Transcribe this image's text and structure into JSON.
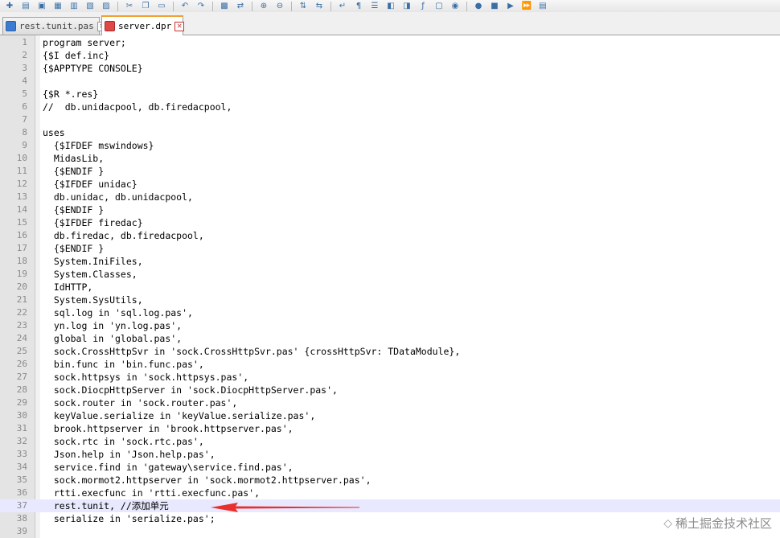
{
  "toolbar": {
    "buttons": [
      {
        "name": "new-file-icon",
        "glyph": "✚"
      },
      {
        "name": "open-file-icon",
        "glyph": "▤"
      },
      {
        "name": "save-icon",
        "glyph": "▣"
      },
      {
        "name": "save-all-icon",
        "glyph": "▦"
      },
      {
        "name": "close-file-icon",
        "glyph": "▥"
      },
      {
        "name": "close-all-icon",
        "glyph": "▧"
      },
      {
        "name": "print-icon",
        "glyph": "▨"
      },
      {
        "sep": true
      },
      {
        "name": "cut-icon",
        "glyph": "✂"
      },
      {
        "name": "copy-icon",
        "glyph": "❐"
      },
      {
        "name": "paste-icon",
        "glyph": "▭"
      },
      {
        "sep": true
      },
      {
        "name": "undo-icon",
        "glyph": "↶"
      },
      {
        "name": "redo-icon",
        "glyph": "↷"
      },
      {
        "sep": true
      },
      {
        "name": "find-icon",
        "glyph": "▩"
      },
      {
        "name": "replace-icon",
        "glyph": "⇄"
      },
      {
        "sep": true
      },
      {
        "name": "zoom-in-icon",
        "glyph": "⊕"
      },
      {
        "name": "zoom-out-icon",
        "glyph": "⊖"
      },
      {
        "sep": true
      },
      {
        "name": "sync-vertical-icon",
        "glyph": "⇅"
      },
      {
        "name": "sync-horizontal-icon",
        "glyph": "⇆"
      },
      {
        "sep": true
      },
      {
        "name": "word-wrap-icon",
        "glyph": "↵"
      },
      {
        "name": "show-all-chars-icon",
        "glyph": "¶"
      },
      {
        "name": "indent-guide-icon",
        "glyph": "☰"
      },
      {
        "name": "language-icon",
        "glyph": "◧"
      },
      {
        "name": "document-map-icon",
        "glyph": "◨"
      },
      {
        "name": "function-list-icon",
        "glyph": "ƒ"
      },
      {
        "name": "folder-workspace-icon",
        "glyph": "▢"
      },
      {
        "name": "monitoring-icon",
        "glyph": "◉"
      },
      {
        "sep": true
      },
      {
        "name": "record-macro-icon",
        "glyph": "●"
      },
      {
        "name": "stop-macro-icon",
        "glyph": "■"
      },
      {
        "name": "play-macro-icon",
        "glyph": "▶"
      },
      {
        "name": "run-macro-multiple-icon",
        "glyph": "⏩"
      },
      {
        "name": "save-macro-icon",
        "glyph": "▤"
      }
    ]
  },
  "tabs": [
    {
      "label": "rest.tunit.pas",
      "state": "saved",
      "active": false
    },
    {
      "label": "server.dpr",
      "state": "modified",
      "active": true
    }
  ],
  "editor": {
    "current_line": 37,
    "lines": [
      {
        "n": "1",
        "t": "program server;"
      },
      {
        "n": "2",
        "t": "{$I def.inc}"
      },
      {
        "n": "3",
        "t": "{$APPTYPE CONSOLE}"
      },
      {
        "n": "4",
        "t": ""
      },
      {
        "n": "5",
        "t": "{$R *.res}"
      },
      {
        "n": "6",
        "t": "//  db.unidacpool, db.firedacpool,"
      },
      {
        "n": "7",
        "t": ""
      },
      {
        "n": "8",
        "t": "uses"
      },
      {
        "n": "9",
        "t": "  {$IFDEF mswindows}"
      },
      {
        "n": "10",
        "t": "  MidasLib,"
      },
      {
        "n": "11",
        "t": "  {$ENDIF }"
      },
      {
        "n": "12",
        "t": "  {$IFDEF unidac}"
      },
      {
        "n": "13",
        "t": "  db.unidac, db.unidacpool,"
      },
      {
        "n": "14",
        "t": "  {$ENDIF }"
      },
      {
        "n": "15",
        "t": "  {$IFDEF firedac}"
      },
      {
        "n": "16",
        "t": "  db.firedac, db.firedacpool,"
      },
      {
        "n": "17",
        "t": "  {$ENDIF }"
      },
      {
        "n": "18",
        "t": "  System.IniFiles,"
      },
      {
        "n": "19",
        "t": "  System.Classes,"
      },
      {
        "n": "20",
        "t": "  IdHTTP,"
      },
      {
        "n": "21",
        "t": "  System.SysUtils,"
      },
      {
        "n": "22",
        "t": "  sql.log in 'sql.log.pas',"
      },
      {
        "n": "23",
        "t": "  yn.log in 'yn.log.pas',"
      },
      {
        "n": "24",
        "t": "  global in 'global.pas',"
      },
      {
        "n": "25",
        "t": "  sock.CrossHttpSvr in 'sock.CrossHttpSvr.pas' {crossHttpSvr: TDataModule},"
      },
      {
        "n": "26",
        "t": "  bin.func in 'bin.func.pas',"
      },
      {
        "n": "27",
        "t": "  sock.httpsys in 'sock.httpsys.pas',"
      },
      {
        "n": "28",
        "t": "  sock.DiocpHttpServer in 'sock.DiocpHttpServer.pas',"
      },
      {
        "n": "29",
        "t": "  sock.router in 'sock.router.pas',"
      },
      {
        "n": "30",
        "t": "  keyValue.serialize in 'keyValue.serialize.pas',"
      },
      {
        "n": "31",
        "t": "  brook.httpserver in 'brook.httpserver.pas',"
      },
      {
        "n": "32",
        "t": "  sock.rtc in 'sock.rtc.pas',"
      },
      {
        "n": "33",
        "t": "  Json.help in 'Json.help.pas',"
      },
      {
        "n": "34",
        "t": "  service.find in 'gateway\\service.find.pas',"
      },
      {
        "n": "35",
        "t": "  sock.mormot2.httpserver in 'sock.mormot2.httpserver.pas',"
      },
      {
        "n": "36",
        "t": "  rtti.execfunc in 'rtti.execfunc.pas',"
      },
      {
        "n": "37",
        "t": "  rest.tunit, //添加单元"
      },
      {
        "n": "38",
        "t": "  serialize in 'serialize.pas';"
      },
      {
        "n": "39",
        "t": ""
      }
    ]
  },
  "colors": {
    "current_line": "#e8e8ff",
    "annotation_arrow": "#e8302f",
    "active_tab_accent": "#f0a030"
  },
  "watermark": {
    "text": "稀土掘金技术社区",
    "icon": "juejin-logo-icon"
  }
}
